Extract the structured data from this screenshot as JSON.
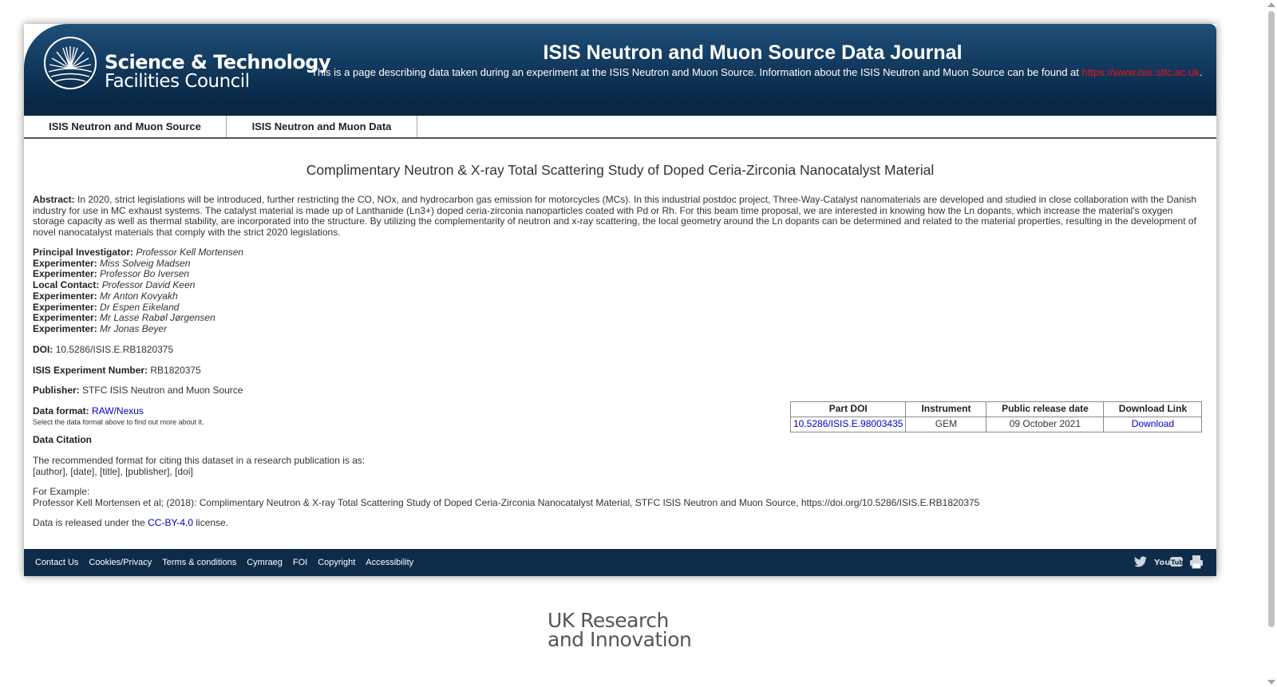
{
  "header": {
    "logo_line1": "Science & Technology",
    "logo_line2": "Facilities Council",
    "title": "ISIS Neutron and Muon Source Data Journal",
    "description": "This is a page describing data taken during an experiment at the ISIS Neutron and Muon Source. Information about the ISIS Neutron and Muon Source can be found at",
    "link": "https://www.isis.stfc.ac.uk",
    "link_suffix": "."
  },
  "nav": {
    "items": [
      {
        "label": "ISIS Neutron and Muon Source"
      },
      {
        "label": "ISIS Neutron and Muon Data"
      }
    ]
  },
  "main": {
    "title": "Complimentary Neutron & X-ray Total Scattering Study of Doped Ceria-Zirconia Nanocatalyst Material",
    "abstract_label": "Abstract:",
    "abstract": "In 2020, strict legislations will be introduced, further restricting the CO, NOx, and hydrocarbon gas emission for motorcycles (MCs). In this industrial postdoc project, Three-Way-Catalyst nanomaterials are developed and studied in close collaboration with the Danish industry for use in MC exhaust systems. The catalyst material is made up of Lanthanide (Ln3+) doped ceria-zirconia nanoparticles coated with Pd or Rh. For this beam time proposal, we are interested in knowing how the Ln dopants, which increase the material's oxygen storage capacity as well as thermal stability, are incorporated into the structure. By utilizing the complementarity of neutron and x-ray scattering, the local geometry around the Ln dopants can be determined and related to the material properties, resulting in the development of novel nanocatalyst materials that comply with the strict 2020 legislations.",
    "people": [
      {
        "role": "Principal Investigator:",
        "name": "Professor Kell Mortensen"
      },
      {
        "role": "Experimenter:",
        "name": "Miss Solveig Madsen"
      },
      {
        "role": "Experimenter:",
        "name": "Professor Bo Iversen"
      },
      {
        "role": "Local Contact:",
        "name": "Professor David Keen"
      },
      {
        "role": "Experimenter:",
        "name": "Mr Anton Kovyakh"
      },
      {
        "role": "Experimenter:",
        "name": "Dr Espen Eikeland"
      },
      {
        "role": "Experimenter:",
        "name": "Mr Lasse Rabøl Jørgensen"
      },
      {
        "role": "Experimenter:",
        "name": "Mr Jonas Beyer"
      }
    ],
    "doi_label": "DOI:",
    "doi": "10.5286/ISIS.E.RB1820375",
    "exp_label": "ISIS Experiment Number:",
    "exp_number": "RB1820375",
    "publisher_label": "Publisher:",
    "publisher": "STFC ISIS Neutron and Muon Source",
    "format_label": "Data format:",
    "format": "RAW/Nexus",
    "format_hint": "Select the data format above to find out more about it.",
    "citation_heading": "Data Citation",
    "citation_intro": "The recommended format for citing this dataset in a research publication is as:",
    "citation_format": "[author], [date], [title], [publisher], [doi]",
    "example_label": "For Example:",
    "example": "Professor Kell Mortensen et al; (2018): Complimentary Neutron & X-ray Total Scattering Study of Doped Ceria-Zirconia Nanocatalyst Material, STFC ISIS Neutron and Muon Source, https://doi.org/10.5286/ISIS.E.RB1820375",
    "license_prefix": "Data is released under the",
    "license": "CC-BY-4.0",
    "license_suffix": "license."
  },
  "table": {
    "headers": [
      "Part DOI",
      "Instrument",
      "Public release date",
      "Download Link"
    ],
    "rows": [
      [
        "10.5286/ISIS.E.98003435",
        "GEM",
        "09 October 2021",
        "Download"
      ]
    ]
  },
  "footer": {
    "links": [
      "Contact Us",
      "Cookies/Privacy",
      "Terms & conditions",
      "Cymraeg",
      "FOI",
      "Copyright",
      "Accessibility"
    ],
    "social": [
      "twitter-icon",
      "youtube-icon",
      "print-icon"
    ]
  },
  "ukri": {
    "line1": "UK Research",
    "line2": "and Innovation"
  },
  "colors": {
    "header_dark": "#0b2b4a",
    "header_light": "#1f4f79",
    "link_red": "#e8141b",
    "link_blue": "#0000cc",
    "footer_bg": "#0e2c4a"
  }
}
